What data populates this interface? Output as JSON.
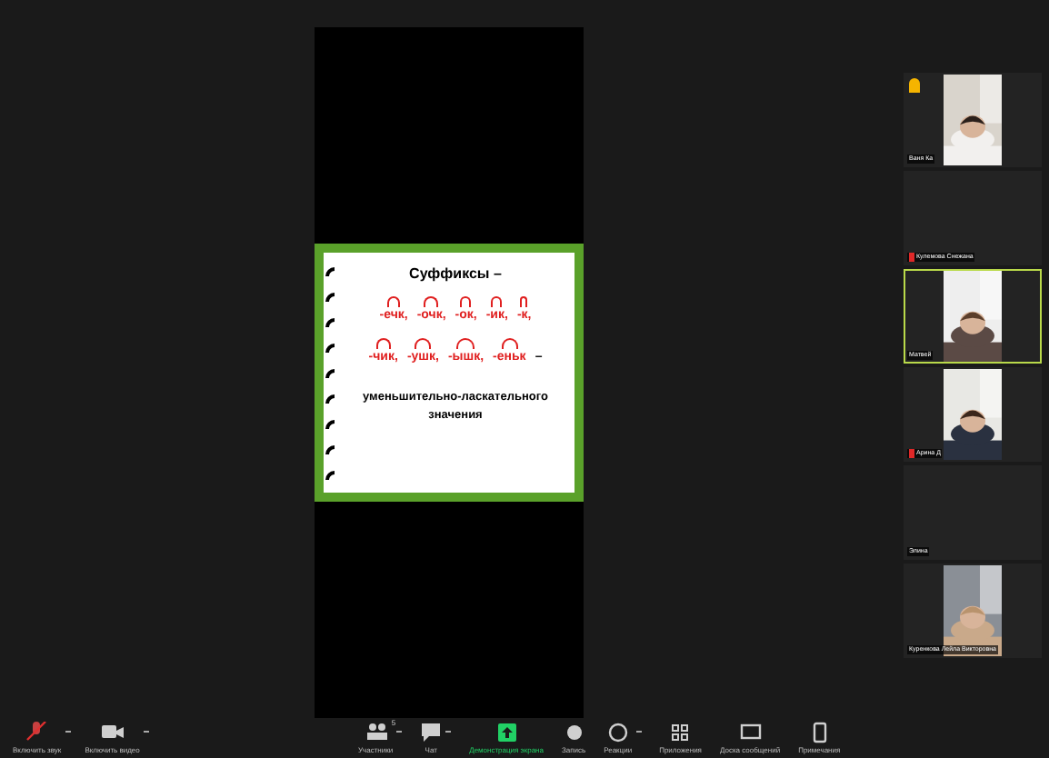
{
  "slide": {
    "title": "Суффиксы –",
    "rows": [
      [
        "-ечк,",
        "-очк,",
        "-ок,",
        "-ик,",
        "-к,"
      ],
      [
        "-чик,",
        "-ушк,",
        "-ышк,",
        "-еньк"
      ]
    ],
    "row_end": "–",
    "caption": "уменьшительно-ласкательного значения"
  },
  "participants": [
    {
      "name": "Ваня Ка",
      "kind": "video",
      "muted": false,
      "hand_raised": true,
      "speaking": false
    },
    {
      "name": "Кулемова Снежана",
      "kind": "empty",
      "muted": true,
      "hand_raised": false,
      "speaking": false
    },
    {
      "name": "Матвей",
      "kind": "video",
      "muted": false,
      "hand_raised": false,
      "speaking": true
    },
    {
      "name": "Арина Д",
      "kind": "video",
      "muted": true,
      "hand_raised": false,
      "speaking": false
    },
    {
      "name": "Элина",
      "kind": "empty",
      "muted": false,
      "hand_raised": false,
      "speaking": false
    },
    {
      "name": "Куренкова Лейла Викторовна",
      "kind": "video",
      "muted": false,
      "hand_raised": false,
      "speaking": false
    }
  ],
  "toolbar_left": [
    {
      "label": "Включить звук",
      "kind": "mic",
      "muted": true,
      "caret": true
    },
    {
      "label": "Включить видео",
      "kind": "camera",
      "caret": true
    }
  ],
  "toolbar_center": [
    {
      "label": "Участники",
      "kind": "people",
      "badge": "5",
      "active": false,
      "caret": true
    },
    {
      "label": "Чат",
      "kind": "chat",
      "active": false,
      "caret": true
    },
    {
      "label": "Демонстрация экрана",
      "kind": "share",
      "active": true,
      "caret": false
    },
    {
      "label": "Запись",
      "kind": "record",
      "active": false,
      "caret": false
    },
    {
      "label": "Реакции",
      "kind": "smile",
      "active": false,
      "caret": true
    },
    {
      "label": "Приложения",
      "kind": "apps",
      "active": false,
      "caret": false
    },
    {
      "label": "Доска сообщений",
      "kind": "board",
      "active": false,
      "caret": false
    },
    {
      "label": "Примечания",
      "kind": "notes",
      "active": false,
      "caret": false
    }
  ]
}
